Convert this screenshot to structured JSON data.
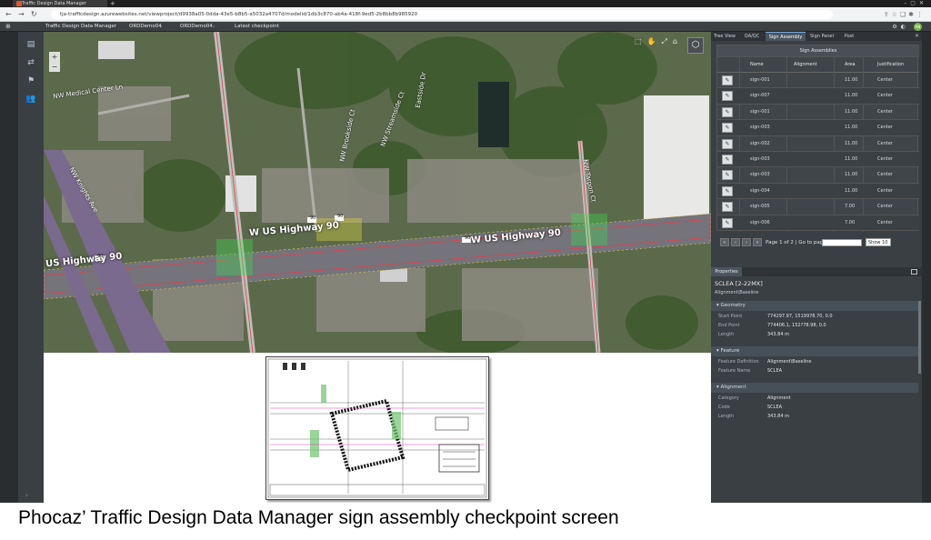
{
  "browser": {
    "tab_title": "Traffic Design Data Manager",
    "url": "tja-trafficdesign.azurewebsites.net/viewproject/d9938a05-0dda-43e5-b8b5-a5032a4707d/modelid/1db3c870-ab4a-418f-9ed5-2b8bb8b985920"
  },
  "header": {
    "app_name": "Traffic Design Data Manager",
    "crumbs": [
      "ORDDemo04",
      "ORDDemo04",
      "Latest checkpoint"
    ],
    "avatar_initials": "AN"
  },
  "map": {
    "streets": [
      "NW Medical Center Ln",
      "NW Brookside Ct",
      "NW Streamside Ct",
      "Eastside Dr",
      "NW Tarpon Ct",
      "NW Knights Ave"
    ],
    "highway_labels": [
      "W US Highway 90",
      "W US Highway 90",
      "US Highway 90"
    ],
    "route_badges": [
      "90",
      "90",
      "90",
      "90"
    ]
  },
  "panel": {
    "tabs": [
      "Tree View",
      "QA/QC",
      "Sign Assembly",
      "Sign Panel",
      "Post"
    ],
    "active_tab": "Sign Assembly",
    "table_title": "Sign Assemblies",
    "columns": [
      "Name",
      "Alignment",
      "Area",
      "Justification"
    ],
    "rows": [
      {
        "name": "sign-001",
        "alignment": "",
        "area": "11.00",
        "justification": "Center"
      },
      {
        "name": "sign-007",
        "alignment": "",
        "area": "11.00",
        "justification": "Center"
      },
      {
        "name": "sign-001",
        "alignment": "",
        "area": "11.00",
        "justification": "Center"
      },
      {
        "name": "sign-003",
        "alignment": "",
        "area": "11.00",
        "justification": "Center"
      },
      {
        "name": "sign-002",
        "alignment": "",
        "area": "11.00",
        "justification": "Center"
      },
      {
        "name": "sign-003",
        "alignment": "",
        "area": "11.00",
        "justification": "Center"
      },
      {
        "name": "sign-003",
        "alignment": "",
        "area": "11.00",
        "justification": "Center"
      },
      {
        "name": "sign-004",
        "alignment": "",
        "area": "11.00",
        "justification": "Center"
      },
      {
        "name": "sign-005",
        "alignment": "",
        "area": "7.00",
        "justification": "Center"
      },
      {
        "name": "sign-006",
        "alignment": "",
        "area": "7.00",
        "justification": "Center"
      }
    ],
    "pager": {
      "text": "Page 1 of 2 | Go to page:",
      "page_size": "Show 10"
    },
    "properties": {
      "tab_label": "Properties",
      "title": "SCLEA [2-22MX]",
      "subtitle": "Alignment\\Baseline",
      "sections": [
        {
          "name": "Geometry",
          "rows": [
            {
              "label": "Start Point",
              "value": "774297.97, 1519978.70, 0.0"
            },
            {
              "label": "End Point",
              "value": "774406.1, 152?78.98, 0.0"
            },
            {
              "label": "Length",
              "value": "343.84 m"
            }
          ]
        },
        {
          "name": "Feature",
          "rows": [
            {
              "label": "Feature Definition",
              "value": "Alignment\\Baseline"
            },
            {
              "label": "Feature Name",
              "value": "SCLEA"
            }
          ]
        },
        {
          "name": "Alignment",
          "rows": [
            {
              "label": "Category",
              "value": "Alignment"
            },
            {
              "label": "Code",
              "value": "SCLEA"
            },
            {
              "label": "Length",
              "value": "343.84 m"
            }
          ]
        }
      ]
    }
  },
  "caption": "Phocaz’ Traffic Design Data Manager sign assembly checkpoint screen"
}
